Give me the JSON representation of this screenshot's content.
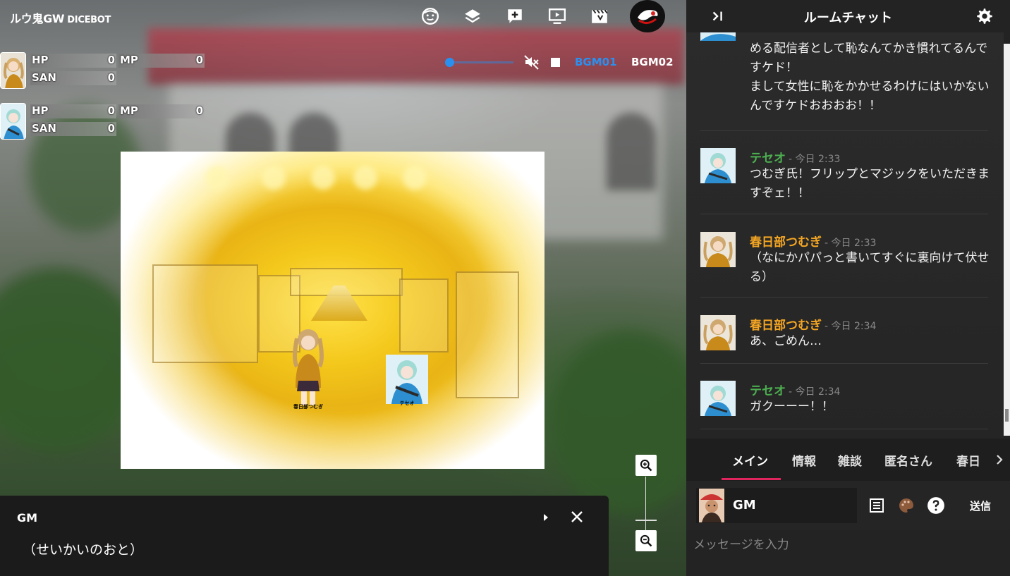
{
  "app": {
    "title": "ルウ鬼GW",
    "subtitle": "DICEBOT"
  },
  "toolbar": {
    "icons": [
      "character-face-icon",
      "layers-icon",
      "add-box-icon",
      "screen-play-icon",
      "clapperboard-icon",
      "user-avatar-icon"
    ]
  },
  "status_panels": [
    {
      "hp_label": "HP",
      "hp_value": "0",
      "mp_label": "MP",
      "mp_value": "0",
      "san_label": "SAN",
      "san_value": "0"
    },
    {
      "hp_label": "HP",
      "hp_value": "0",
      "mp_label": "MP",
      "mp_value": "0",
      "san_label": "SAN",
      "san_value": "0"
    }
  ],
  "audio": {
    "volume_level": 0.03,
    "bgm1": "BGM01",
    "bgm2": "BGM02",
    "muted": true
  },
  "map": {
    "pieces": [
      {
        "name": "春日部つむぎ"
      },
      {
        "name": "テセオ"
      }
    ]
  },
  "message_box": {
    "speaker": "GM",
    "text": "（せいかいのおと）"
  },
  "chat": {
    "title": "ルームチャット",
    "messages": [
      {
        "author": "",
        "time": "",
        "body": "める配信者として恥なんてかき慣れてるんですケド！\nまして女性に恥をかかせるわけにはいかないんですケドおおおお！！",
        "color": "#ffffff"
      },
      {
        "author": "テセオ",
        "time": "- 今日 2:33",
        "body": "つむぎ氏！フリップとマジックをいただきますぞェ！！",
        "color": "#4caf50"
      },
      {
        "author": "春日部つむぎ",
        "time": "- 今日 2:33",
        "body": "（なにかパパっと書いてすぐに裏向けて伏せる）",
        "color": "#f5a623"
      },
      {
        "author": "春日部つむぎ",
        "time": "- 今日 2:34",
        "body": "あ、ごめん…",
        "color": "#f5a623"
      },
      {
        "author": "テセオ",
        "time": "- 今日 2:34",
        "body": "ガクーーー！！",
        "color": "#4caf50"
      }
    ],
    "tabs": [
      "メイン",
      "情報",
      "雑談",
      "匿名さん",
      "春日"
    ],
    "active_tab": "メイン",
    "sender_name": "GM",
    "send_label": "送信",
    "input_placeholder": "メッセージを入力"
  },
  "colors": {
    "accent": "#e0245e",
    "link": "#2a90f0",
    "green_name": "#4caf50",
    "orange_name": "#f5a623"
  }
}
